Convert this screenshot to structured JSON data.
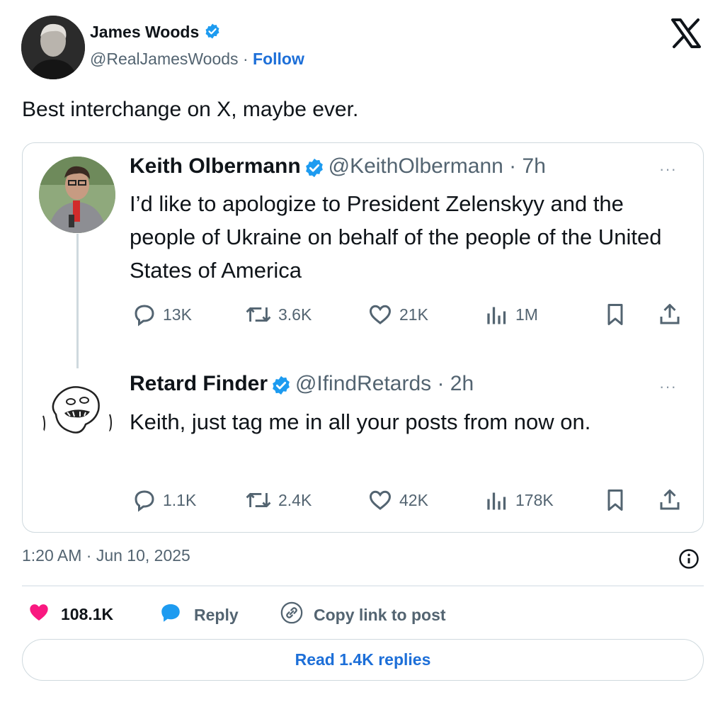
{
  "post": {
    "author_name": "James Woods",
    "author_handle": "@RealJamesWoods",
    "separator": "·",
    "follow_label": "Follow",
    "text": "Best interchange on X, maybe ever.",
    "timestamp": "1:20 AM · Jun 10, 2025",
    "likes": "108.1K",
    "reply_label": "Reply",
    "copy_link_label": "Copy link to post",
    "read_replies_label": "Read 1.4K replies"
  },
  "quoted": [
    {
      "name": "Keith Olbermann",
      "handle": "@KeithOlbermann · 7h",
      "more": "···",
      "text": "I’d like to apologize to President Zelenskyy and the people of Ukraine on behalf of the people of the United States of America",
      "replies": "13K",
      "reposts": "3.6K",
      "likes": "21K",
      "views": "1M"
    },
    {
      "name": "Retard Finder",
      "handle": "@IfindRetards · 2h",
      "more": "···",
      "text": "Keith, just tag me in all your posts from now on.",
      "replies": "1.1K",
      "reposts": "2.4K",
      "likes": "42K",
      "views": "178K"
    }
  ],
  "icons": {
    "verified": "verified-badge-icon",
    "x_logo": "x-logo-icon",
    "reply": "speech-bubble-icon",
    "repost": "repost-icon",
    "like": "heart-icon",
    "views": "bar-chart-icon",
    "bookmark": "bookmark-icon",
    "share": "share-icon",
    "info": "info-icon",
    "link": "link-icon"
  },
  "colors": {
    "accent": "#1d6fd8",
    "verified": "#1d9bf0",
    "like_heart": "#f91880",
    "text_muted": "#536471",
    "border": "#cfd9de"
  }
}
